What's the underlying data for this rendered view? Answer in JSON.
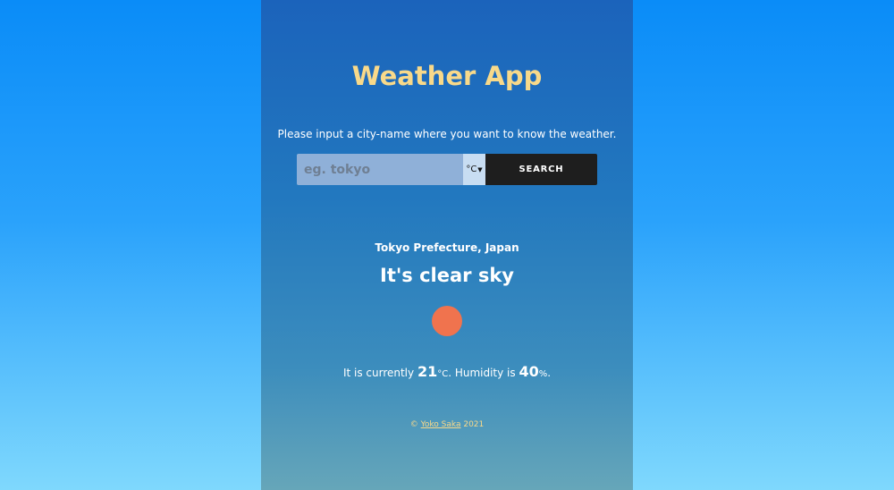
{
  "app": {
    "title": "Weather App",
    "prompt": "Please input a city-name where you want to know the weather."
  },
  "search": {
    "placeholder": "eg. tokyo",
    "value": "",
    "unit": "°C",
    "unit_options": [
      "°C"
    ],
    "button_label": "SEARCH"
  },
  "result": {
    "location": "Tokyo Prefecture, Japan",
    "condition": "It's clear sky",
    "prefix": "It is currently ",
    "temperature": "21",
    "temp_unit": "°C",
    "humidity_text": ". Humidity is ",
    "humidity": "40",
    "humidity_unit": "%",
    "suffix": "."
  },
  "footer": {
    "copyright": "© ",
    "author": "Yoko Saka",
    "year": " 2021"
  },
  "colors": {
    "title": "#f8d98a",
    "sun": "#f0734e",
    "button_bg": "#1e1e1e"
  },
  "icons": {
    "weather": "sun-icon"
  }
}
